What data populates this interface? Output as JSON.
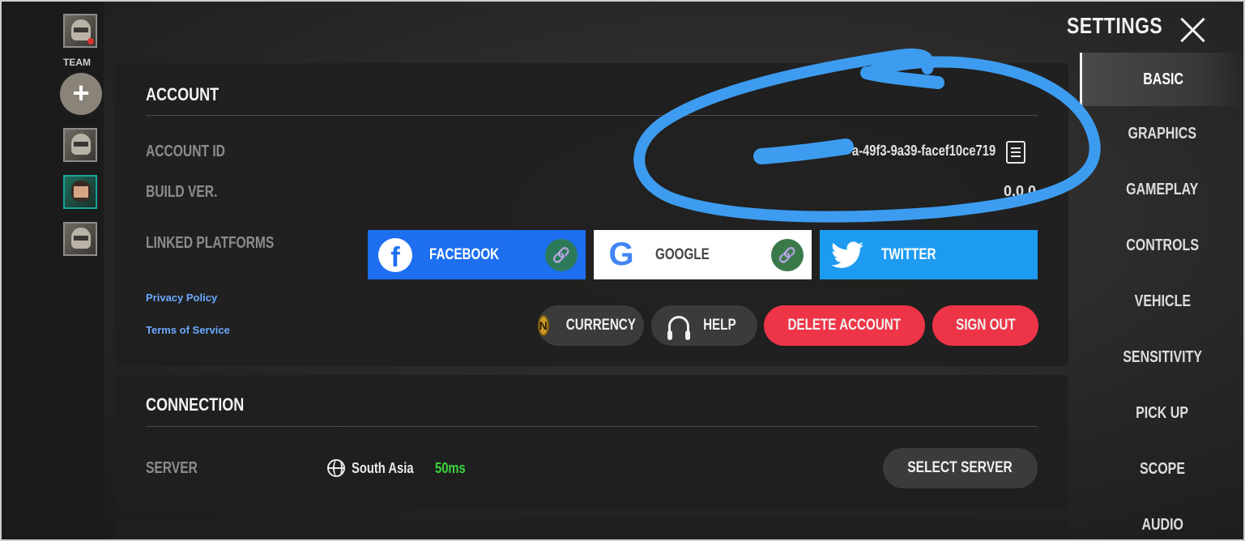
{
  "team": {
    "label": "TEAM",
    "add_label": "+"
  },
  "header": {
    "title": "SETTINGS"
  },
  "tabs": [
    {
      "label": "BASIC",
      "active": true
    },
    {
      "label": "GRAPHICS",
      "active": false
    },
    {
      "label": "GAMEPLAY",
      "active": false
    },
    {
      "label": "CONTROLS",
      "active": false
    },
    {
      "label": "VEHICLE",
      "active": false
    },
    {
      "label": "SENSITIVITY",
      "active": false
    },
    {
      "label": "PICK UP",
      "active": false
    },
    {
      "label": "SCOPE",
      "active": false
    },
    {
      "label": "AUDIO",
      "active": false
    }
  ],
  "account": {
    "title": "ACCOUNT",
    "id_label": "ACCOUNT ID",
    "id_value": "a-49f3-9a39-facef10ce719",
    "build_label": "BUILD VER.",
    "build_value": "0.0.0",
    "linked_label": "LINKED PLATFORMS",
    "platforms": {
      "facebook": "FACEBOOK",
      "google": "GOOGLE",
      "twitter": "TWITTER"
    },
    "privacy": "Privacy Policy",
    "terms": "Terms of Service",
    "currency": "CURRENCY",
    "currency_icon": "N",
    "help": "HELP",
    "delete": "DELETE ACCOUNT",
    "signout": "SIGN OUT"
  },
  "connection": {
    "title": "CONNECTION",
    "server_label": "SERVER",
    "server_name": "South Asia",
    "ping": "50ms",
    "select_server": "SELECT SERVER"
  },
  "colors": {
    "accent_red": "#ee3447",
    "facebook": "#1d6ff0",
    "twitter": "#1d9bf0",
    "ping_green": "#3cd43c",
    "scribble": "#3d9cf0"
  }
}
